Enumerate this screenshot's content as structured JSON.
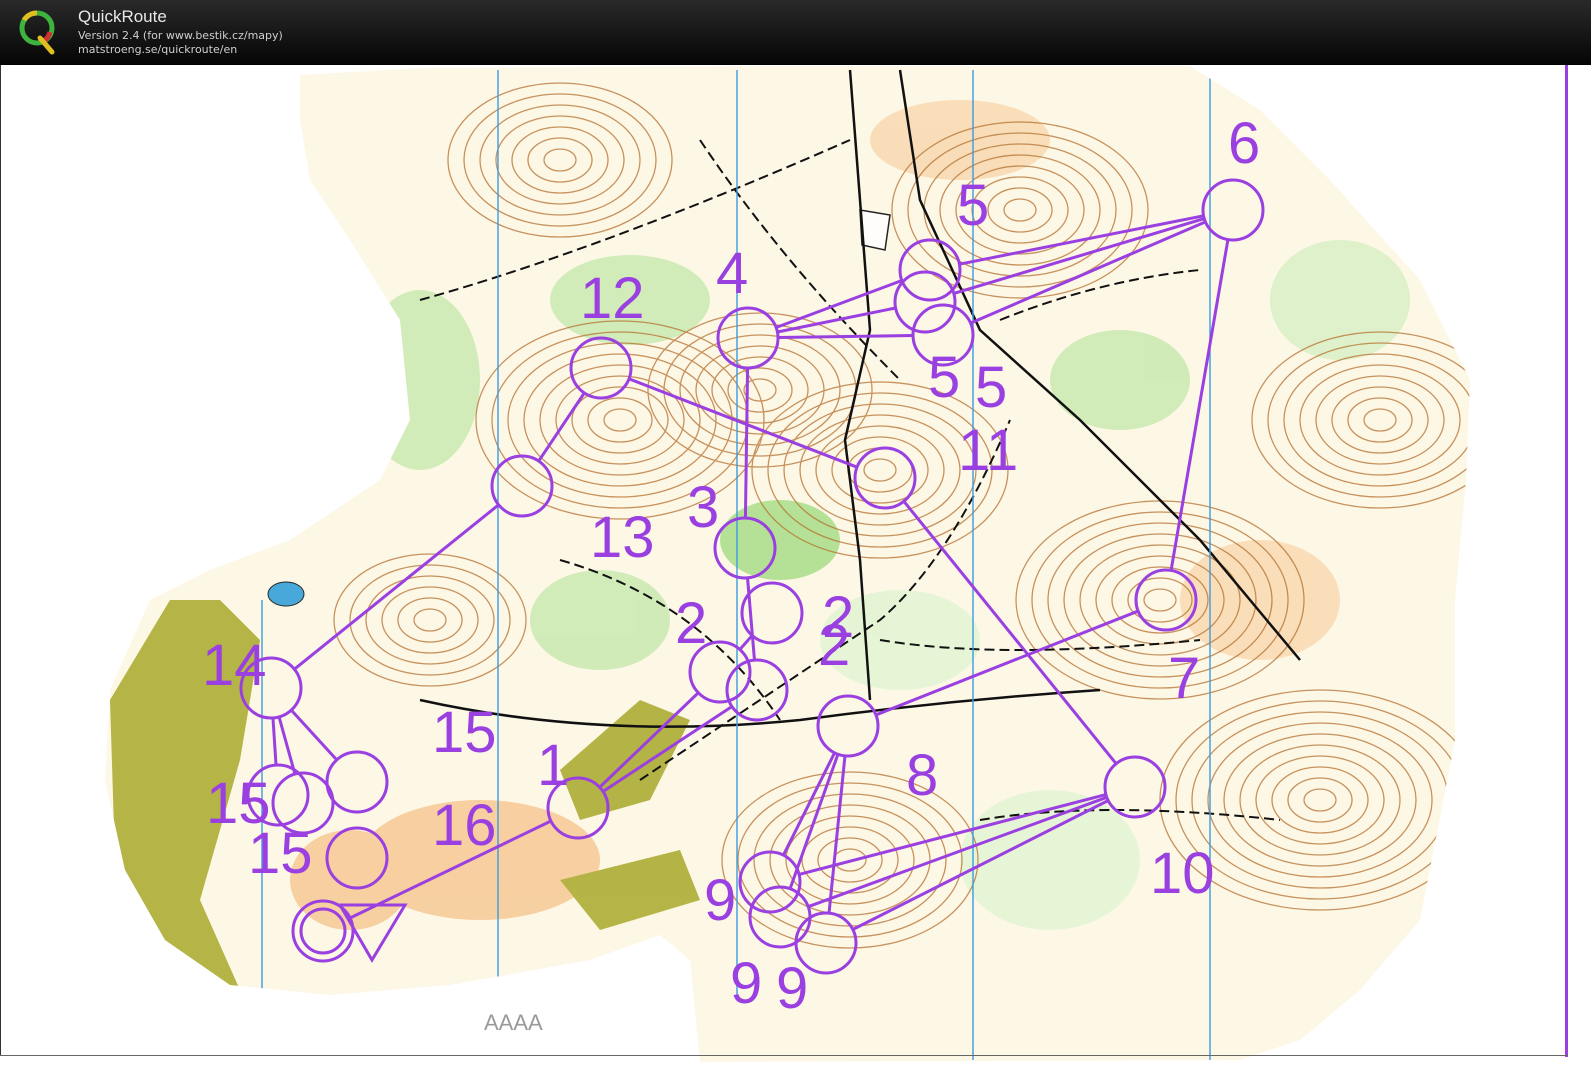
{
  "app": {
    "title": "QuickRoute",
    "version": "Version 2.4  (for www.bestik.cz/mapy)",
    "url": "matstroeng.se/quickroute/en"
  },
  "map": {
    "label": "AAAA",
    "course_color": "#9a3fe0",
    "control_labels": [
      "1",
      "2",
      "2",
      "2",
      "3",
      "4",
      "5",
      "5",
      "5",
      "6",
      "7",
      "8",
      "9",
      "9",
      "9",
      "10",
      "11",
      "12",
      "13",
      "14",
      "15",
      "15",
      "15",
      "16"
    ]
  },
  "icons": [
    "quickroute-logo-icon"
  ]
}
